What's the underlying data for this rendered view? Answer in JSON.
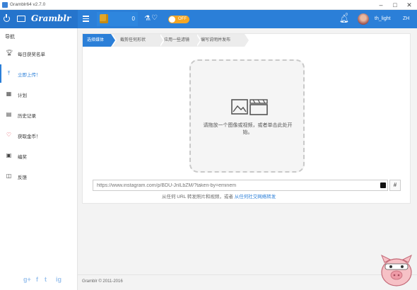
{
  "window": {
    "title": "Gramblr64 v2.7.0"
  },
  "header": {
    "logo": "Gramblr",
    "coins": "0",
    "toggle_label": "OFF",
    "notification_count": "0",
    "username": "th_light",
    "language": "ZH"
  },
  "sidebar": {
    "title": "导航",
    "items": [
      {
        "label": "每日获奖名单",
        "icon": "trophy-icon"
      },
      {
        "label": "立即上传！",
        "icon": "upload-icon",
        "active": true
      },
      {
        "label": "计划",
        "icon": "calendar-icon"
      },
      {
        "label": "历史记录",
        "icon": "history-icon"
      },
      {
        "label": "获取金币！",
        "icon": "heart-icon"
      },
      {
        "label": "编奖",
        "icon": "gift-icon"
      },
      {
        "label": "反馈",
        "icon": "feedback-icon"
      }
    ],
    "social": [
      "g+",
      "f",
      "t",
      "ig"
    ]
  },
  "steps": [
    "选择媒体",
    "截剪任何形状",
    "应用一些滤镜",
    "编写说明并发布"
  ],
  "dropzone": {
    "text": "请拖放一个图像或视频，或者单击此处开始。"
  },
  "url": {
    "placeholder": "https://www.instagram.com/p/BDU-JnlLbZM/?taken-by=eminem",
    "hash_button": "#",
    "hint_prefix": "从任何 URL 转发照片和视频，或者",
    "hint_link": "从任何社交网络转发"
  },
  "footer": {
    "copyright": "Gramblr © 2011-2016"
  },
  "colors": {
    "accent": "#2b7fd8",
    "toggle": "#f5a623",
    "heart": "#e0394a"
  }
}
